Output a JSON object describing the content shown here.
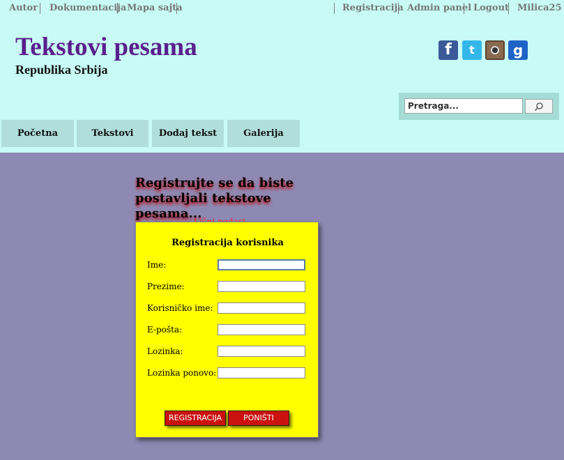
{
  "topnav": {
    "left": [
      "Autor",
      "Dokumentacija",
      "Mapa sajta"
    ],
    "right": [
      "Registracija",
      "Admin panel",
      "Logout",
      "Milica25"
    ]
  },
  "header": {
    "title": "Tekstovi pesama",
    "subtitle": "Republika Srbija"
  },
  "social": {
    "icons": [
      "facebook-icon",
      "twitter-icon",
      "instagram-icon",
      "google-icon"
    ],
    "glyphs": [
      "f",
      "t",
      "",
      "g"
    ]
  },
  "search": {
    "placeholder": "Pretraga...",
    "button_icon": "search-icon"
  },
  "menu": [
    "Početna",
    "Tekstovi",
    "Dodaj tekst",
    "Galerija"
  ],
  "form": {
    "heading": "Registrujte se da biste postavljali tekstove pesama...",
    "legend": "Lični podaci",
    "title": "Registracija korisnika",
    "fields": [
      "Ime:",
      "Prezime:",
      "Korisničko ime:",
      "E-pošta:",
      "Lozinka:",
      "Lozinka ponovo:"
    ],
    "submit": "REGISTRACIJA",
    "reset": "PONIŠTI"
  },
  "colors": {
    "background": "#c8fbf5",
    "title": "#5a1f8c",
    "content": "#8e89b3",
    "panel": "#ffff00",
    "button": "#cc1111"
  }
}
